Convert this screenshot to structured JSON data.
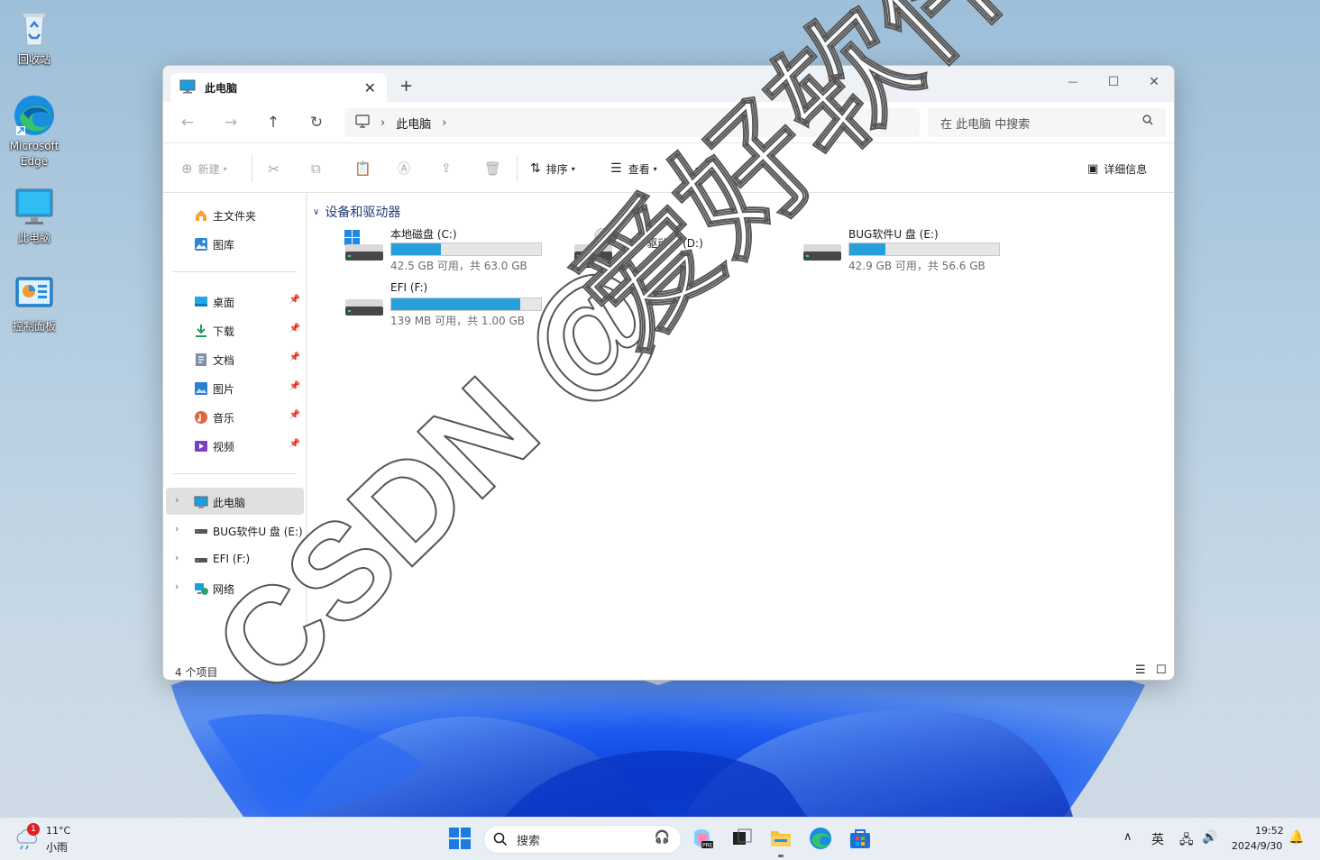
{
  "desktop": {
    "icons": [
      {
        "label": "回收站",
        "icon": "recycle-bin-icon"
      },
      {
        "label": "Microsoft Edge",
        "icon": "edge-icon"
      },
      {
        "label": "此电脑",
        "icon": "computer-icon"
      },
      {
        "label": "控制面板",
        "icon": "control-panel-icon"
      }
    ]
  },
  "window": {
    "tab_title": "此电脑",
    "new_tab": "+",
    "controls": {
      "minimize": "—",
      "maximize": "☐",
      "close": "✕"
    },
    "breadcrumb": {
      "current": "此电脑"
    },
    "search_placeholder": "在 此电脑 中搜索",
    "toolbar": {
      "new_label": "新建",
      "sort_label": "排序",
      "view_label": "查看",
      "more_label": "···",
      "details_label": "详细信息"
    },
    "nav": {
      "home": "主文件夹",
      "gallery": "图库",
      "quick_access": [
        {
          "label": "桌面",
          "icon": "desktop-folder-icon"
        },
        {
          "label": "下载",
          "icon": "download-icon"
        },
        {
          "label": "文档",
          "icon": "document-icon"
        },
        {
          "label": "图片",
          "icon": "pictures-icon"
        },
        {
          "label": "音乐",
          "icon": "music-icon"
        },
        {
          "label": "视频",
          "icon": "video-icon"
        }
      ],
      "this_pc": "此电脑",
      "drive_e": "BUG软件U 盘 (E:)",
      "drive_f": "EFI (F:)",
      "network": "网络"
    },
    "group_title": "设备和驱动器",
    "drives": [
      {
        "name": "本地磁盘 (C:)",
        "info": "42.5 GB 可用，共 63.0 GB",
        "used_fraction": 0.33
      },
      {
        "name": "DVD 驱动器 (D:)",
        "info": "",
        "used_fraction": null
      },
      {
        "name": "BUG软件U 盘 (E:)",
        "info": "42.9 GB 可用，共 56.6 GB",
        "used_fraction": 0.24
      },
      {
        "name": "EFI (F:)",
        "info": "139 MB 可用，共 1.00 GB",
        "used_fraction": 0.86
      }
    ],
    "dvd_badge": "DVD",
    "status": "4 个项目"
  },
  "watermark": {
    "line1": "CSDN @",
    "line2": "爱好软件"
  },
  "taskbar": {
    "weather_temp": "11°C",
    "weather_desc": "小雨",
    "weather_badge": "1",
    "search_label": "搜索",
    "tray_lang": "英",
    "time": "19:52",
    "date": "2024/9/30"
  },
  "colors": {
    "accent": "#26a0da",
    "group_title": "#1f3d7a",
    "taskbar": "#e9eef5"
  }
}
